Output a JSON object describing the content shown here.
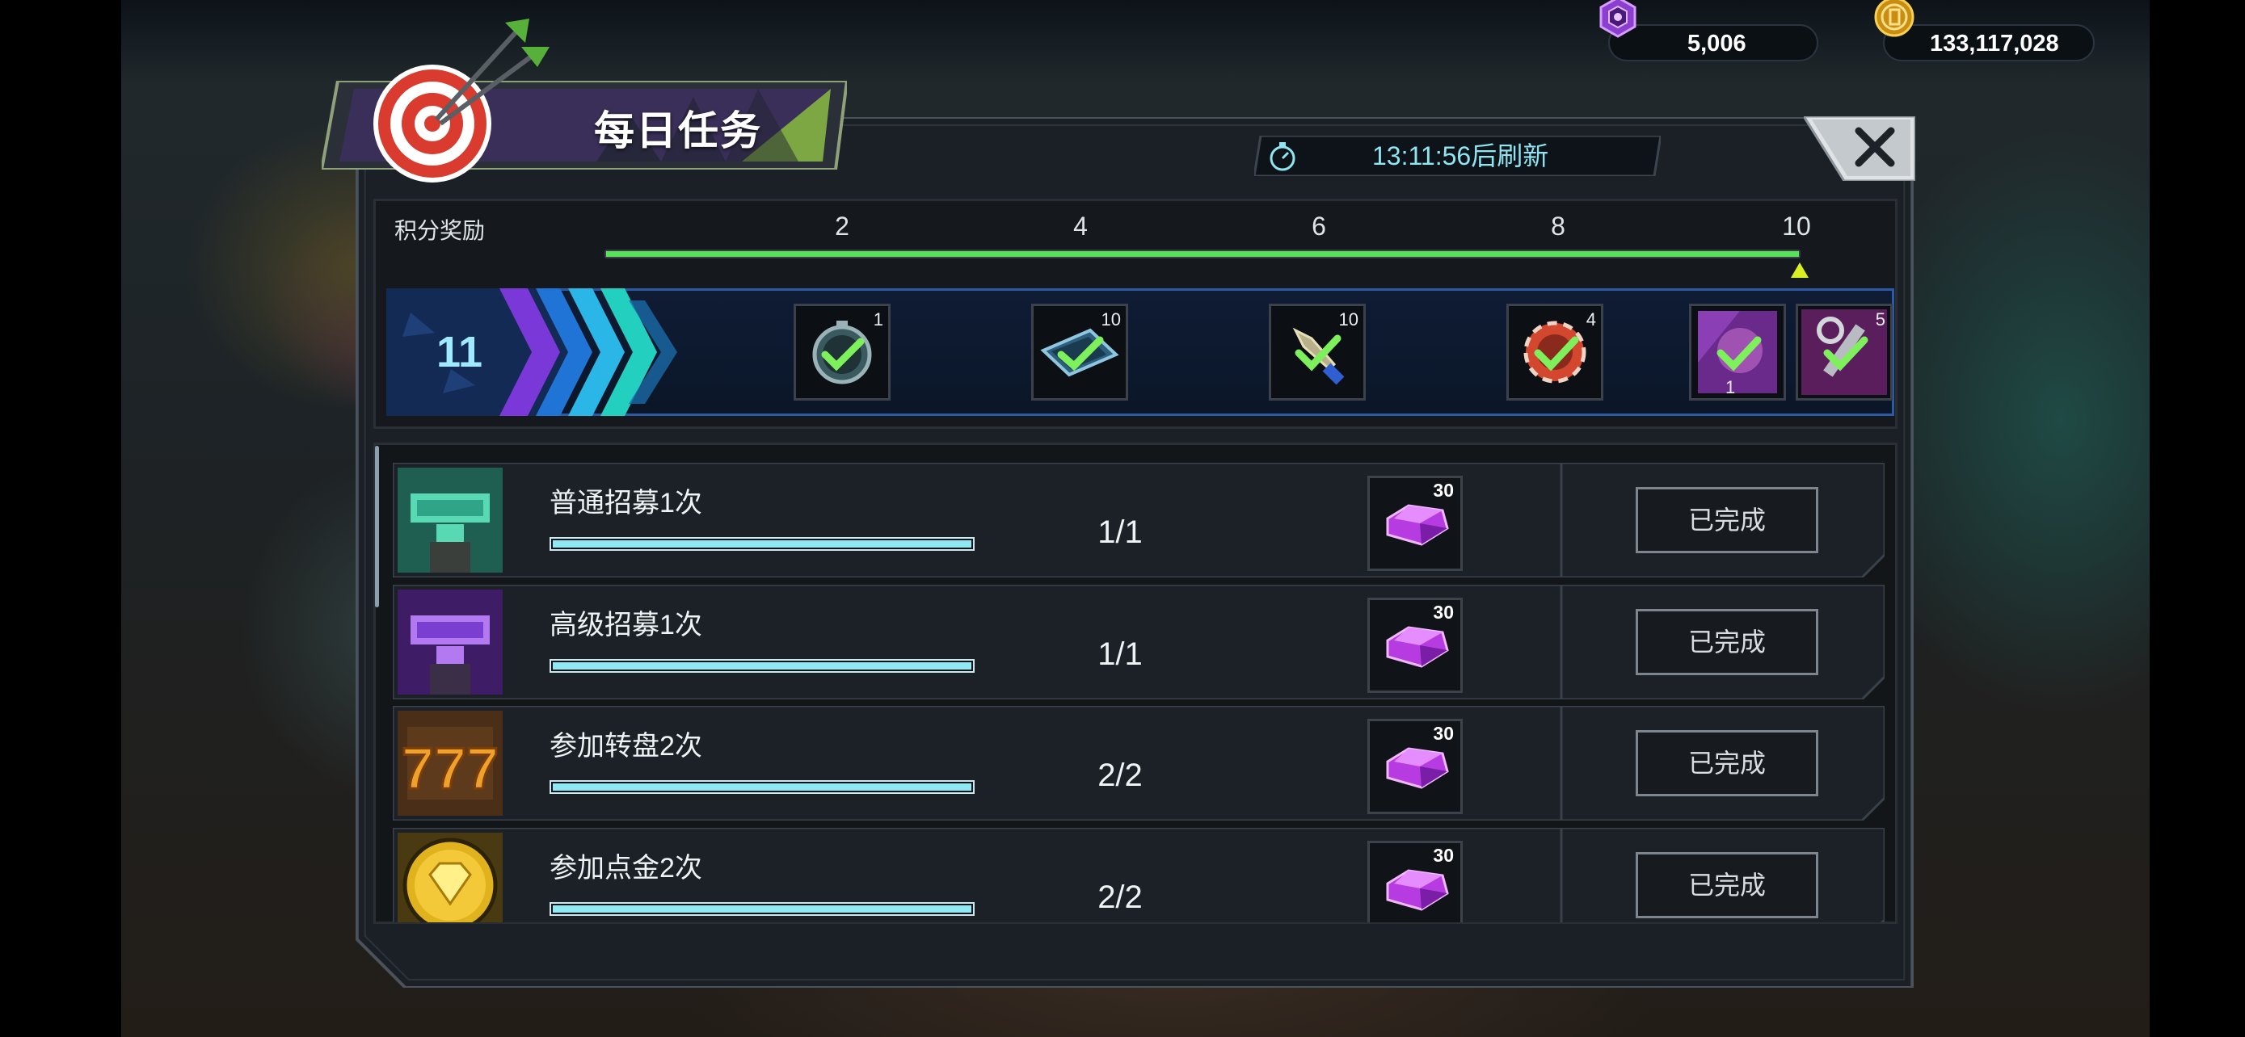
{
  "currency": {
    "gems": "5,006",
    "coins": "133,117,028"
  },
  "panel": {
    "title": "每日任务",
    "timer": "13:11:56后刷新"
  },
  "points": {
    "label": "积分奖励",
    "ticks": [
      "2",
      "4",
      "6",
      "8",
      "10"
    ],
    "score": "11",
    "progress_fraction": 1.0,
    "rewards": [
      {
        "icon": "stopwatch-icon",
        "count": "1",
        "claimed": true
      },
      {
        "icon": "ticket-icon",
        "count": "10",
        "claimed": true
      },
      {
        "icon": "dagger-icon",
        "count": "10",
        "claimed": true
      },
      {
        "icon": "chip-icon",
        "count": "4",
        "claimed": true
      },
      {
        "icon": "card-pack-icon",
        "count": "1",
        "claimed": true
      },
      {
        "icon": "wrench-icon",
        "count": "5",
        "claimed": true
      }
    ]
  },
  "tasks": [
    {
      "name": "普通招募1次",
      "progress": "1/1",
      "progress_fraction": 1.0,
      "reward": "30",
      "status": "已完成",
      "icon": "green-machine-icon"
    },
    {
      "name": "高级招募1次",
      "progress": "1/1",
      "progress_fraction": 1.0,
      "reward": "30",
      "status": "已完成",
      "icon": "purple-machine-icon"
    },
    {
      "name": "参加转盘2次",
      "progress": "2/2",
      "progress_fraction": 1.0,
      "reward": "30",
      "status": "已完成",
      "icon": "slot-777-icon"
    },
    {
      "name": "参加点金2次",
      "progress": "2/2",
      "progress_fraction": 1.0,
      "reward": "30",
      "status": "已完成",
      "icon": "gold-diamond-icon"
    }
  ],
  "colors": {
    "track": "#56e35a",
    "task_bar": "#8fe8f4",
    "timer_text": "#8fe6f0",
    "gem": "#b63be0"
  }
}
